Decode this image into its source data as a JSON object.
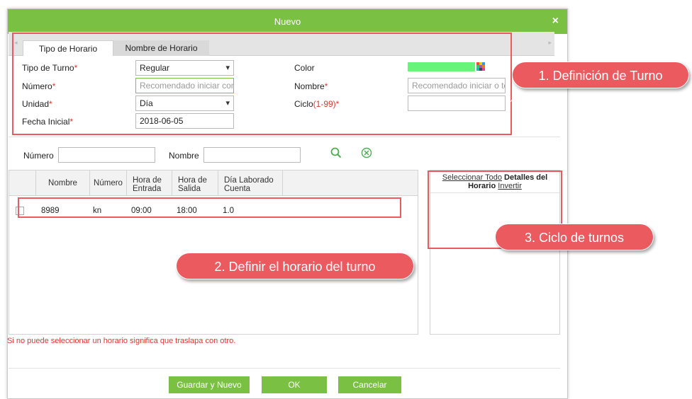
{
  "dialog": {
    "title": "Nuevo",
    "close_glyph": "×"
  },
  "tabs": [
    {
      "label": "Tipo de Horario",
      "active": true
    },
    {
      "label": "Nombre de Horario",
      "active": false
    }
  ],
  "form": {
    "tipo_turno": {
      "label": "Tipo de Turno",
      "req": "*",
      "value": "Regular"
    },
    "numero": {
      "label": "Número",
      "req": "*",
      "placeholder": "Recomendado iniciar con l"
    },
    "unidad": {
      "label": "Unidad",
      "req": "*",
      "value": "Día"
    },
    "fecha_inicial": {
      "label": "Fecha Inicial",
      "req": "*",
      "value": "2018-06-05"
    },
    "color": {
      "label": "Color",
      "value": "#66f57a"
    },
    "nombre": {
      "label": "Nombre",
      "req": "*",
      "placeholder": "Recomendado iniciar o terr"
    },
    "ciclo": {
      "label": "Ciclo",
      "range": "(1-99)*",
      "value": ""
    }
  },
  "filter": {
    "numero_label": "Número",
    "nombre_label": "Nombre",
    "search_icon": "search-icon",
    "clear_icon": "clear-icon"
  },
  "grid": {
    "headers": {
      "nombre": "Nombre",
      "numero": "Número",
      "hora_entrada_1": "Hora de",
      "hora_entrada_2": "Entrada",
      "hora_salida_1": "Hora de",
      "hora_salida_2": "Salida",
      "dia_1": "Día Laborado",
      "dia_2": "Cuenta"
    },
    "rows": [
      {
        "nombre": "8989",
        "numero": "kn",
        "entrada": "09:00",
        "salida": "18:00",
        "dias": "1.0",
        "checked": false
      }
    ]
  },
  "panel": {
    "select_all": "Seleccionar Todo",
    "details_1": "Detalles del",
    "details_2": "Horario",
    "invert": "Invertir"
  },
  "warning": "Si no puede seleccionar un horario significa que traslapa con otro.",
  "buttons": {
    "save_new": "Guardar y Nuevo",
    "ok": "OK",
    "cancel": "Cancelar"
  },
  "annotations": {
    "callout_1": "1. Definición de Turno",
    "callout_2": "2. Definir el horario del turno",
    "callout_3": "3. Ciclo de turnos",
    "accent": "#ea5a5f"
  },
  "theme": {
    "accent": "#7ac143",
    "required": "#e6332a"
  }
}
